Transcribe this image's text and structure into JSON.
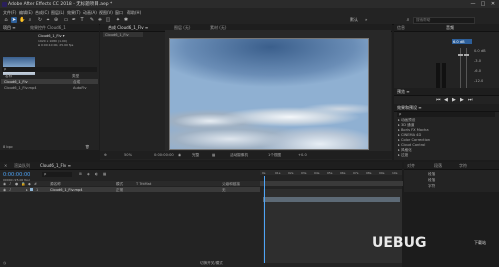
{
  "window": {
    "title": "Adobe After Effects CC 2018 - 无标题项目.aep *",
    "min": "—",
    "max": "□",
    "close": "✕"
  },
  "menu": [
    "文件(F)",
    "编辑(E)",
    "合成(C)",
    "图层(L)",
    "效果(T)",
    "动画(A)",
    "视图(V)",
    "窗口",
    "帮助(H)"
  ],
  "toolbar": {
    "workspace_label": "默认",
    "search_placeholder": "搜索帮助"
  },
  "project": {
    "tab": "项目 ≡",
    "tab2": "效果控件 Cloud6_1",
    "item_name": "Cloud6_1_Flv ▾",
    "item_info": "1920 x 1080 (1.00)",
    "item_info2": "Δ 0:00:10:00, 25.00 fps",
    "search_placeholder": "ρ",
    "col_name": "名称",
    "col_type": "类型",
    "rows": [
      {
        "name": "Cloud6_1_Flv",
        "type": "合成"
      },
      {
        "name": "Cloud6_1_Flv.mp4",
        "type": "AutoFlv"
      }
    ],
    "bpc": "8 bpc"
  },
  "composition": {
    "tabs": [
      "合成 Cloud6_1_Flv ≡",
      "图层 (无)",
      "素材 (无)"
    ],
    "breadcrumb": "Cloud6_1_Flv",
    "footer": {
      "zoom": "50%",
      "timecode": "0:00:00:00",
      "quality": "完整",
      "camera": "活动摄像机",
      "views": "1个视图",
      "offset": "+0.0"
    }
  },
  "right_panel": {
    "info_tab": "信息",
    "audio_tab": "音频",
    "audio_label": "6.0 dB",
    "db_values": [
      "0.0",
      "-6.0",
      "-12.0",
      "-18.0",
      "-24.0"
    ],
    "db_right": [
      "0.0 dB",
      "-3.0",
      "-6.0",
      "-12.0",
      "-18.0"
    ],
    "preview_tab": "预览 ≡",
    "effects_tab": "效果和预设 ≡",
    "effects_search": "ρ",
    "effects_list": [
      "▸ 动画预设",
      "▸ 3D 通道",
      "▸ Boris FX Mocha",
      "▸ CINEMA 4D",
      "▸ Color Correction",
      "▸ Cloud Control",
      "▸ 风格化",
      "▸ 过渡"
    ],
    "align_tab": "对齐",
    "paragraph_tab": "段落",
    "char_tab": "字符",
    "lib_items": [
      "段落",
      "段落",
      "字符"
    ],
    "render_tab": "渲染"
  },
  "timeline": {
    "tab": "Cloud6_1_Flv ≡",
    "render_tab": "渲染队列",
    "timecode": "0:00:00:00",
    "fps": "00000 (25.00 fps)",
    "col_src": "源名称",
    "col_mode": "模式",
    "col_trkmat": "T TrkMat",
    "col_parent": "父级和链接",
    "layer_num": "1",
    "layer_name": "Cloud6_1_Flv.mp4",
    "layer_mode": "正常",
    "layer_parent": "无",
    "ruler": [
      "0s",
      "01s",
      "02s",
      "03s",
      "04s",
      "05s",
      "06s",
      "07s",
      "08s",
      "09s",
      "10s"
    ],
    "toggle": "切换开关/模式"
  },
  "watermark": {
    "main": "UEBUG",
    "sub": "下载站"
  }
}
